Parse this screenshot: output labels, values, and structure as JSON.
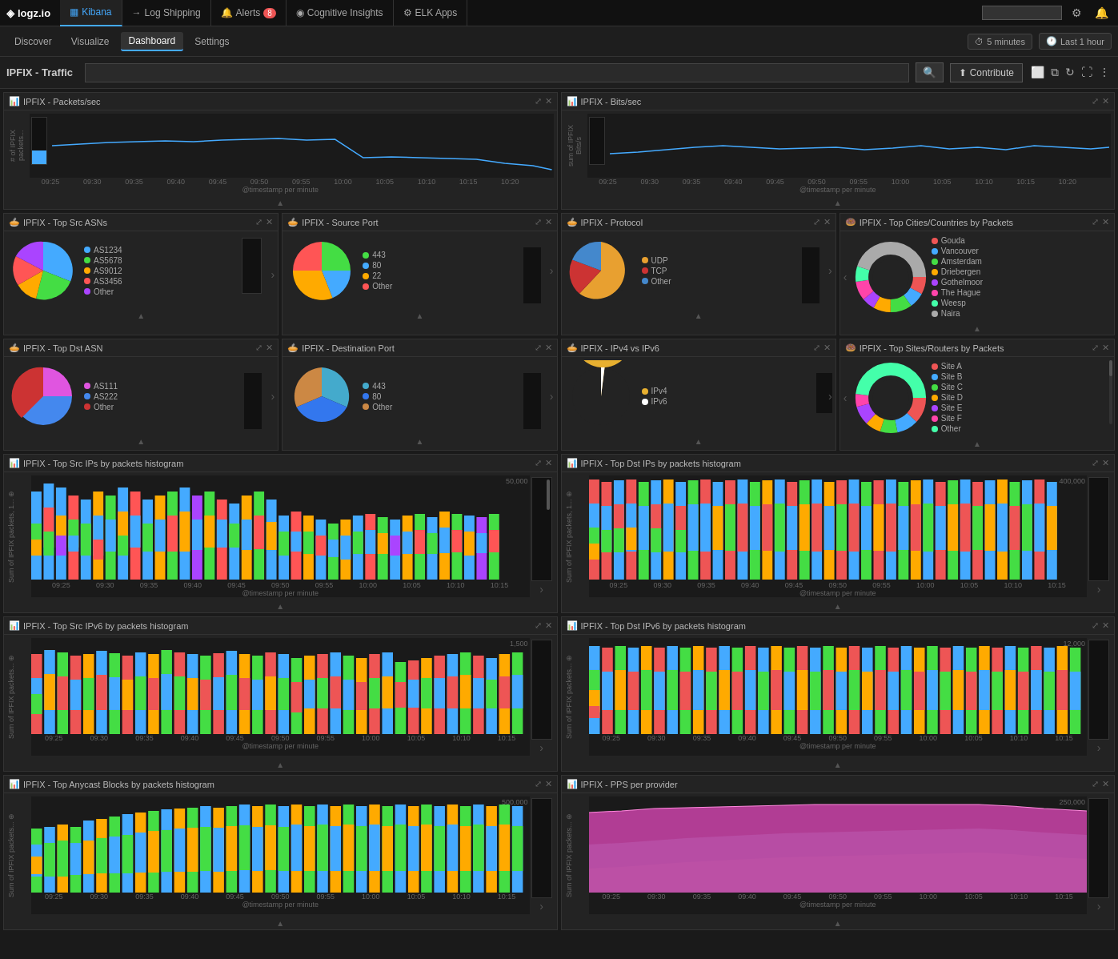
{
  "app": {
    "logo_text": "logz.io",
    "logo_icon": "◈"
  },
  "top_nav": {
    "tabs": [
      {
        "id": "kibana",
        "label": "Kibana",
        "icon": "▦",
        "active": true
      },
      {
        "id": "log-shipping",
        "label": "Log Shipping",
        "icon": "→"
      },
      {
        "id": "alerts",
        "label": "Alerts",
        "icon": "🔔",
        "badge": "8"
      },
      {
        "id": "cognitive-insights",
        "label": "Cognitive Insights",
        "icon": "◉"
      },
      {
        "id": "elk-apps",
        "label": "ELK Apps",
        "icon": "⚙"
      }
    ],
    "search_placeholder": "",
    "settings_icon": "⚙",
    "bell_icon": "🔔"
  },
  "sec_nav": {
    "tabs": [
      {
        "id": "discover",
        "label": "Discover"
      },
      {
        "id": "visualize",
        "label": "Visualize"
      },
      {
        "id": "dashboard",
        "label": "Dashboard",
        "active": true
      },
      {
        "id": "settings",
        "label": "Settings"
      }
    ],
    "time_interval": "5 minutes",
    "time_range": "Last 1 hour"
  },
  "search_row": {
    "page_title": "IPFIX - Traffic",
    "search_placeholder": "",
    "contribute_label": "Contribute",
    "share_icon": "⬜",
    "clone_icon": "⬜",
    "refresh_icon": "↻",
    "fullscreen_icon": "⛶",
    "dots_icon": "⋮"
  },
  "panels": {
    "row1": [
      {
        "id": "packets-sec",
        "title": "IPFIX - Packets/sec",
        "icon": "📊",
        "type": "line",
        "y_label": "# of IPFIX packets..."
      },
      {
        "id": "bits-sec",
        "title": "IPFIX - Bits/sec",
        "icon": "📊",
        "type": "line",
        "y_label": "sum of IPFIX Bits/s"
      }
    ],
    "row2": [
      {
        "id": "top-src-asns",
        "title": "IPFIX - Top Src ASNs",
        "icon": "🥧",
        "type": "pie"
      },
      {
        "id": "source-port",
        "title": "IPFIX - Source Port",
        "icon": "🥧",
        "type": "pie"
      },
      {
        "id": "protocol",
        "title": "IPFIX - Protocol",
        "icon": "🥧",
        "type": "pie"
      },
      {
        "id": "top-cities",
        "title": "IPFIX - Top Cities/Countries by Packets",
        "icon": "🍩",
        "type": "donut"
      }
    ],
    "row3": [
      {
        "id": "top-dst-asn",
        "title": "IPFIX - Top Dst ASN",
        "icon": "🥧",
        "type": "pie"
      },
      {
        "id": "destination-port",
        "title": "IPFIX - Destination Port",
        "icon": "🥧",
        "type": "pie"
      },
      {
        "id": "ipv4-vs-ipv6",
        "title": "IPFIX - IPv4 vs IPv6",
        "icon": "🥧",
        "type": "pie"
      },
      {
        "id": "top-sites-routers",
        "title": "IPFIX - Top Sites/Routers by Packets",
        "icon": "🍩",
        "type": "donut"
      }
    ],
    "row4": [
      {
        "id": "top-src-ips-hist",
        "title": "IPFIX - Top Src IPs by packets histogram",
        "icon": "📊",
        "type": "bar"
      },
      {
        "id": "top-dst-ips-hist",
        "title": "IPFIX - Top Dst IPs by packets histogram",
        "icon": "📊",
        "type": "bar"
      }
    ],
    "row5": [
      {
        "id": "top-src-ipv6-hist",
        "title": "IPFIX - Top Src IPv6 by packets histogram",
        "icon": "📊",
        "type": "bar"
      },
      {
        "id": "top-dst-ipv6-hist",
        "title": "IPFIX - Top Dst IPv6 by packets histogram",
        "icon": "📊",
        "type": "bar"
      }
    ],
    "row6": [
      {
        "id": "top-anycast-hist",
        "title": "IPFIX - Top Anycast Blocks by packets histogram",
        "icon": "📊",
        "type": "bar"
      },
      {
        "id": "pps-provider",
        "title": "IPFIX - PPS per provider",
        "icon": "📊",
        "type": "area"
      }
    ]
  },
  "cities_legend": [
    "Gouda",
    "Vancouver",
    "Amsterdam",
    "Driebergen",
    "Gothelmoor",
    "The Hague",
    "Weesp",
    "Naira"
  ],
  "cities_colors": [
    "#e55",
    "#4af",
    "#4d4",
    "#fa0",
    "#a4f",
    "#f4a",
    "#4fa",
    "#aaa"
  ],
  "pie_colors_asn": [
    "#4af",
    "#4d4",
    "#fa0",
    "#f55",
    "#a4f",
    "#4fa"
  ],
  "pie_colors_port": [
    "#4d4",
    "#4af",
    "#fa0",
    "#f55",
    "#a4f"
  ],
  "pie_colors_protocol": [
    "#e8a030",
    "#cc3333",
    "#4488cc"
  ],
  "pie_colors_dst_asn": [
    "#e055e0",
    "#4488ee",
    "#cc3333",
    "#44aa44"
  ],
  "pie_colors_dst_port": [
    "#44aacc",
    "#3377ee",
    "#cc8844"
  ],
  "pie_colors_ipv4_v6": [
    "#e8b030",
    "#ffffff"
  ],
  "timestamps": [
    "09:25",
    "09:30",
    "09:35",
    "09:40",
    "09:45",
    "09:50",
    "09:55",
    "10:00",
    "10:05",
    "10:10",
    "10:15",
    "10:20"
  ],
  "x_axis_label": "@timestamp per minute"
}
